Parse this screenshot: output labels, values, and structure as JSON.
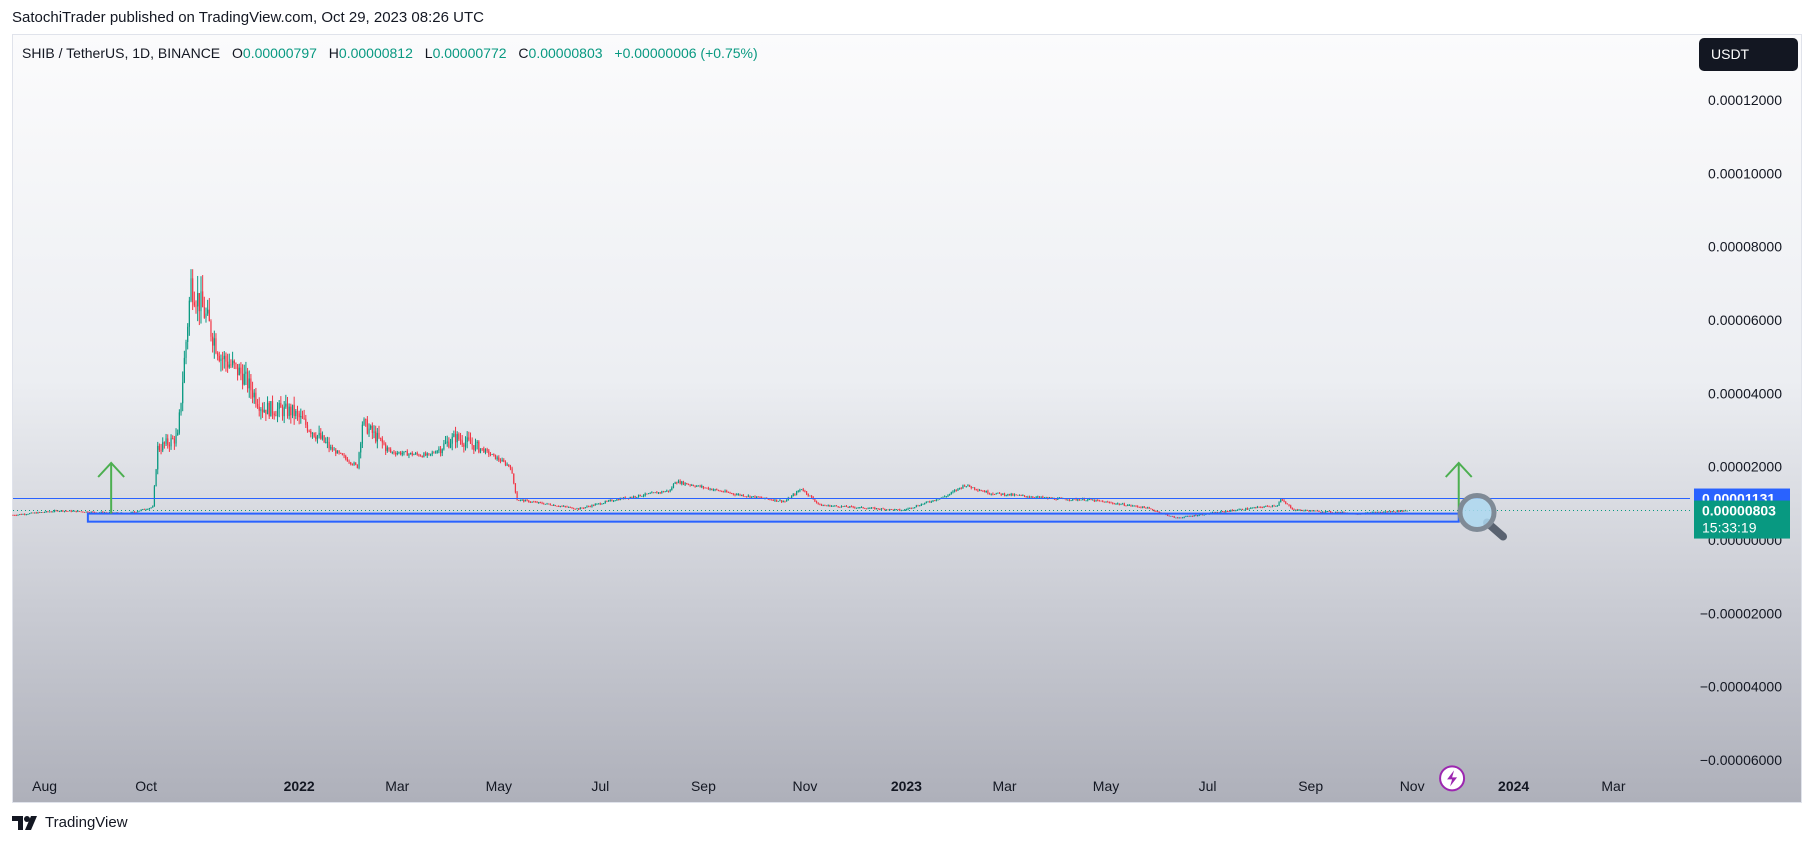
{
  "header": {
    "publisher_line": "SatochiTrader published on TradingView.com, Oct 29, 2023 08:26 UTC"
  },
  "legend": {
    "symbol": "SHIB / TetherUS, 1D, BINANCE",
    "open_label": "O",
    "open": "0.00000797",
    "high_label": "H",
    "high": "0.00000812",
    "low_label": "L",
    "low": "0.00000772",
    "close_label": "C",
    "close": "0.00000803",
    "change": "+0.00000006 (+0.75%)"
  },
  "currency_button": "USDT",
  "price_tags": {
    "resistance": "0.00001131",
    "last_price": "0.00000803",
    "countdown": "15:33:19"
  },
  "footer": {
    "brand": "TradingView"
  },
  "colors": {
    "up": "#089981",
    "down": "#f23645",
    "zone": "#2962ff",
    "arrow": "#4caf50",
    "last_price_bg": "#089981",
    "resistance_bg": "#2962ff"
  },
  "icons": [
    "magnifier-icon",
    "lightning-icon",
    "tradingview-logo-icon"
  ],
  "chart_data": {
    "type": "candlestick",
    "title": "",
    "xlabel": "",
    "ylabel": "",
    "ylim": [
      -7e-05,
      0.000135
    ],
    "grid": false,
    "y_ticks": [
      "0.00012000",
      "0.00010000",
      "0.00008000",
      "0.00006000",
      "0.00004000",
      "0.00002000",
      "0.00000000",
      "−0.00002000",
      "−0.00004000",
      "−0.00006000"
    ],
    "y_tick_values": [
      0.00012,
      0.0001,
      8e-05,
      6e-05,
      4e-05,
      2e-05,
      0.0,
      -2e-05,
      -4e-05,
      -6e-05
    ],
    "x_ticks": [
      {
        "label": "Aug",
        "date": "2021-08-01",
        "bold": false
      },
      {
        "label": "Oct",
        "date": "2021-10-01",
        "bold": false
      },
      {
        "label": "2022",
        "date": "2022-01-01",
        "bold": true
      },
      {
        "label": "Mar",
        "date": "2022-03-01",
        "bold": false
      },
      {
        "label": "May",
        "date": "2022-05-01",
        "bold": false
      },
      {
        "label": "Jul",
        "date": "2022-07-01",
        "bold": false
      },
      {
        "label": "Sep",
        "date": "2022-09-01",
        "bold": false
      },
      {
        "label": "Nov",
        "date": "2022-11-01",
        "bold": false
      },
      {
        "label": "2023",
        "date": "2023-01-01",
        "bold": true
      },
      {
        "label": "Mar",
        "date": "2023-03-01",
        "bold": false
      },
      {
        "label": "May",
        "date": "2023-05-01",
        "bold": false
      },
      {
        "label": "Jul",
        "date": "2023-07-01",
        "bold": false
      },
      {
        "label": "Sep",
        "date": "2023-09-01",
        "bold": false
      },
      {
        "label": "Nov",
        "date": "2023-11-01",
        "bold": false
      },
      {
        "label": "2024",
        "date": "2024-01-01",
        "bold": true
      },
      {
        "label": "Mar",
        "date": "2024-03-01",
        "bold": false
      }
    ],
    "xlim": [
      "2021-07-13",
      "2024-04-10"
    ],
    "price_path": [
      {
        "date": "2021-07-13",
        "close": 6.8e-06
      },
      {
        "date": "2021-08-10",
        "close": 8e-06
      },
      {
        "date": "2021-09-20",
        "close": 7.2e-06
      },
      {
        "date": "2021-10-05",
        "close": 9e-06
      },
      {
        "date": "2021-10-08",
        "close": 2.5e-05
      },
      {
        "date": "2021-10-20",
        "close": 2.8e-05
      },
      {
        "date": "2021-10-28",
        "close": 7e-05
      },
      {
        "date": "2021-11-05",
        "close": 6.2e-05
      },
      {
        "date": "2021-11-15",
        "close": 5e-05
      },
      {
        "date": "2021-11-28",
        "close": 4.5e-05
      },
      {
        "date": "2021-12-10",
        "close": 3.6e-05
      },
      {
        "date": "2021-12-28",
        "close": 3.5e-05
      },
      {
        "date": "2022-01-20",
        "close": 2.5e-05
      },
      {
        "date": "2022-02-05",
        "close": 2e-05
      },
      {
        "date": "2022-02-08",
        "close": 3.2e-05
      },
      {
        "date": "2022-02-25",
        "close": 2.4e-05
      },
      {
        "date": "2022-03-20",
        "close": 2.3e-05
      },
      {
        "date": "2022-04-05",
        "close": 2.8e-05
      },
      {
        "date": "2022-04-20",
        "close": 2.5e-05
      },
      {
        "date": "2022-05-08",
        "close": 2e-05
      },
      {
        "date": "2022-05-12",
        "close": 1.1e-05
      },
      {
        "date": "2022-06-18",
        "close": 8.5e-06
      },
      {
        "date": "2022-07-10",
        "close": 1.1e-05
      },
      {
        "date": "2022-08-12",
        "close": 1.35e-05
      },
      {
        "date": "2022-08-15",
        "close": 1.6e-05
      },
      {
        "date": "2022-09-20",
        "close": 1.25e-05
      },
      {
        "date": "2022-10-20",
        "close": 1.05e-05
      },
      {
        "date": "2022-10-30",
        "close": 1.4e-05
      },
      {
        "date": "2022-11-10",
        "close": 9.5e-06
      },
      {
        "date": "2022-12-30",
        "close": 8.1e-06
      },
      {
        "date": "2023-01-25",
        "close": 1.2e-05
      },
      {
        "date": "2023-02-05",
        "close": 1.5e-05
      },
      {
        "date": "2023-02-20",
        "close": 1.28e-05
      },
      {
        "date": "2023-04-01",
        "close": 1.12e-05
      },
      {
        "date": "2023-04-20",
        "close": 1.1e-05
      },
      {
        "date": "2023-05-25",
        "close": 8.8e-06
      },
      {
        "date": "2023-06-12",
        "close": 6e-06
      },
      {
        "date": "2023-07-15",
        "close": 8e-06
      },
      {
        "date": "2023-08-12",
        "close": 9.5e-06
      },
      {
        "date": "2023-08-14",
        "close": 1.1e-05
      },
      {
        "date": "2023-08-22",
        "close": 8.2e-06
      },
      {
        "date": "2023-09-30",
        "close": 7.2e-06
      },
      {
        "date": "2023-10-29",
        "close": 8.03e-06
      }
    ],
    "annotations": {
      "support_zone": {
        "from": "2021-08-27",
        "to": "2023-11-29",
        "low": 5e-06,
        "high": 7.2e-06
      },
      "resistance_line": 1.131e-05,
      "last_price_line": 8.03e-06,
      "up_arrows": [
        {
          "date": "2021-09-10",
          "from": 7.2e-06,
          "to": 2.1e-05
        },
        {
          "date": "2023-11-29",
          "from": 7.2e-06,
          "to": 2.1e-05
        }
      ],
      "magnifier_at": {
        "date": "2023-12-10",
        "price": 7.5e-06
      },
      "lightning_at": {
        "date": "2023-11-25",
        "price": -6.5e-05
      }
    }
  }
}
